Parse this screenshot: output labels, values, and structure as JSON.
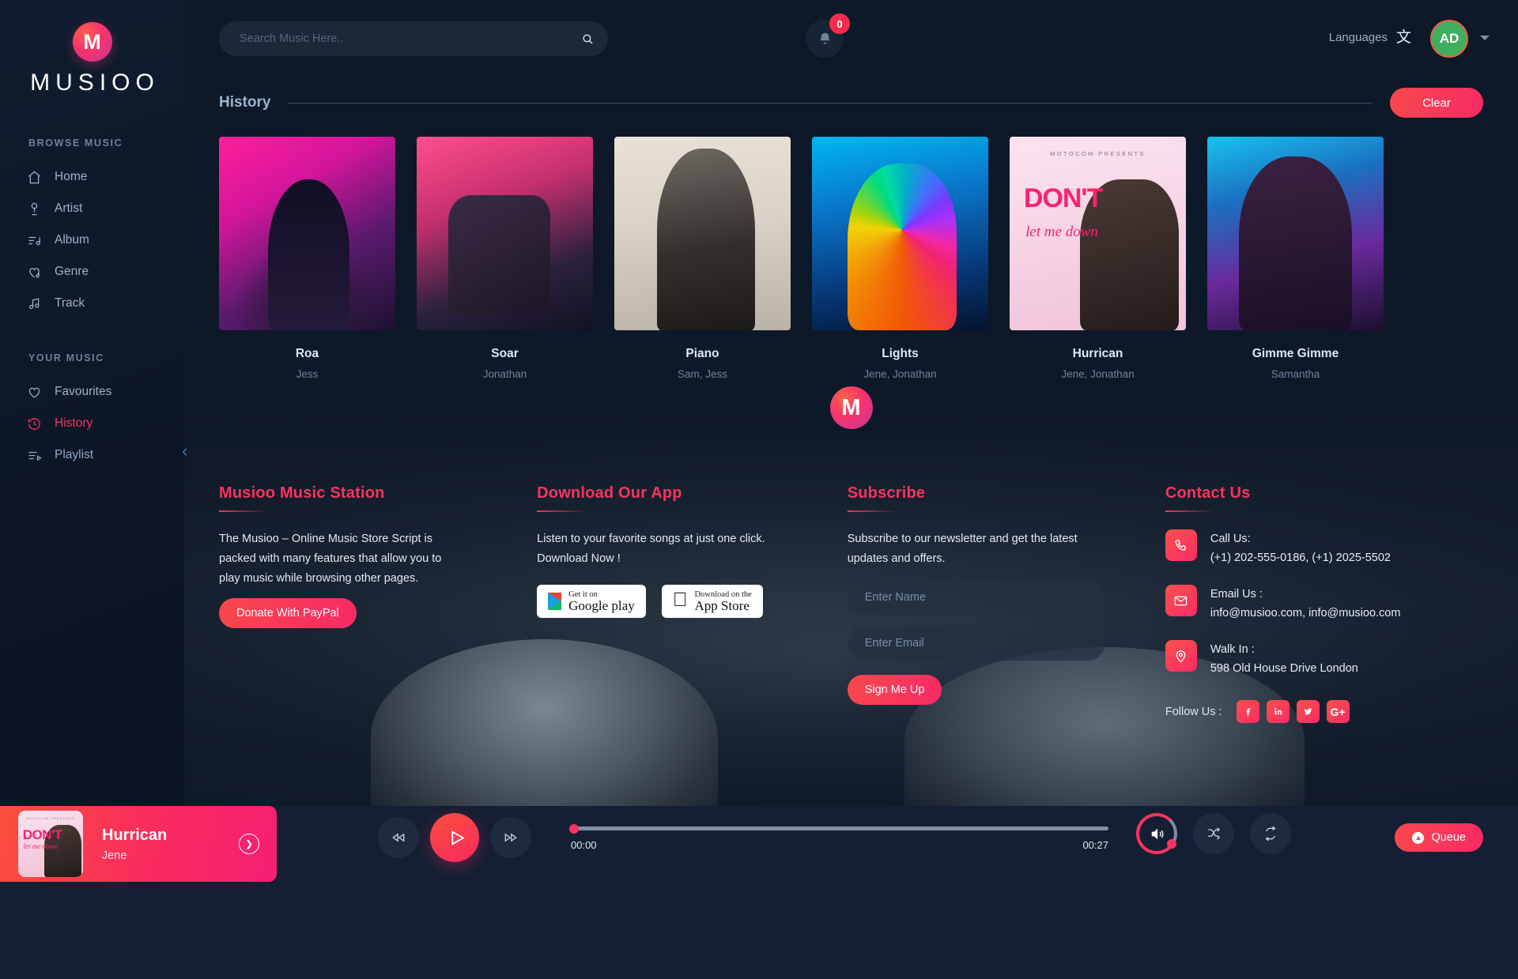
{
  "brand": {
    "logo_letter": "M",
    "name": "MUSIOO"
  },
  "sidebar": {
    "section_browse": "BROWSE MUSIC",
    "section_your": "YOUR MUSIC",
    "browse_items": [
      {
        "label": "Home",
        "icon": "home-icon"
      },
      {
        "label": "Artist",
        "icon": "microphone-icon"
      },
      {
        "label": "Album",
        "icon": "album-icon"
      },
      {
        "label": "Genre",
        "icon": "genre-heart-icon"
      },
      {
        "label": "Track",
        "icon": "music-note-icon"
      }
    ],
    "your_items": [
      {
        "label": "Favourites",
        "icon": "heart-icon"
      },
      {
        "label": "History",
        "icon": "history-clock-icon"
      },
      {
        "label": "Playlist",
        "icon": "playlist-icon"
      }
    ],
    "collapse_icon": "chevron-left-icon"
  },
  "topbar": {
    "search": {
      "placeholder": "Search Music Here..",
      "value": "",
      "icon": "search-icon"
    },
    "notifications": {
      "icon": "bell-icon",
      "count": "0"
    },
    "languages_label": "Languages",
    "languages_icon": "translate-icon",
    "avatar_initials": "AD",
    "avatar_caret_icon": "chevron-down-icon"
  },
  "history": {
    "title": "History",
    "clear_label": "Clear",
    "cards": [
      {
        "title": "Roa",
        "artist": "Jess"
      },
      {
        "title": "Soar",
        "artist": "Jonathan"
      },
      {
        "title": "Piano",
        "artist": "Sam, Jess"
      },
      {
        "title": "Lights",
        "artist": "Jene, Jonathan"
      },
      {
        "title": "Hurrican",
        "artist": "Jene"
      },
      {
        "title": "Gimme Gimme",
        "artist": "Samantha"
      }
    ],
    "card5_art": {
      "presents": "MOTOCOM PRESENTS",
      "dont": "DON'T",
      "letdown": "let me down"
    },
    "card_artists_display": [
      "Jess",
      "Jonathan",
      "Sam, Jess",
      "Jene, Jonathan",
      "Jene, Jonathan",
      "Samantha"
    ]
  },
  "footer": {
    "col1": {
      "title": "Musioo Music Station",
      "body": "The Musioo – Online Music Store Script is packed with many features that allow you to play music while browsing other pages.",
      "button": "Donate With PayPal"
    },
    "col2": {
      "title": "Download Our App",
      "body_line1": "Listen to your favorite songs at just one click.",
      "body_line2": "Download Now !",
      "google_small": "Get it on",
      "google_big": "Google play",
      "apple_small": "Download on the",
      "apple_big": "App Store"
    },
    "col3": {
      "title": "Subscribe",
      "body": "Subscribe to our newsletter and get the latest updates and offers.",
      "name_placeholder": "Enter Name",
      "name_value": "",
      "email_placeholder": "Enter Email",
      "email_value": "",
      "button": "Sign Me Up"
    },
    "col4": {
      "title": "Contact Us",
      "call_label": "Call Us:",
      "call_value": "(+1) 202-555-0186, (+1) 2025-5502",
      "email_label": "Email Us :",
      "email_value": "info@musioo.com, info@musioo.com",
      "walk_label": "Walk In :",
      "walk_value": "598 Old House Drive London",
      "follow_label": "Follow Us :",
      "socials": [
        "facebook-icon",
        "linkedin-icon",
        "twitter-icon",
        "googleplus-icon"
      ]
    },
    "collapse_icon": "chevron-down-icon"
  },
  "player": {
    "now_playing": {
      "title": "Hurrican",
      "artist": "Jene",
      "next_icon": "chevron-right-icon"
    },
    "art": {
      "presents": "MOTOCOM PRESENTS",
      "dont": "DON'T",
      "letdown": "let me down"
    },
    "controls": {
      "prev_icon": "rewind-icon",
      "play_icon": "play-icon",
      "next_icon": "fast-forward-icon",
      "shuffle_icon": "shuffle-icon",
      "repeat_icon": "repeat-icon",
      "volume_icon": "volume-icon"
    },
    "time_current": "00:00",
    "time_total": "00:27",
    "progress_percent": 0,
    "volume_percent": 75,
    "queue_label": "Queue"
  },
  "colors": {
    "accent_pink": "#f8335f",
    "accent_red": "#f8484b",
    "bg_dark": "#0d1828",
    "sidebar_bg": "#101d30",
    "player_bg": "#141f33",
    "avatar_green": "#3fae5e",
    "badge_red": "#f62b4f"
  }
}
